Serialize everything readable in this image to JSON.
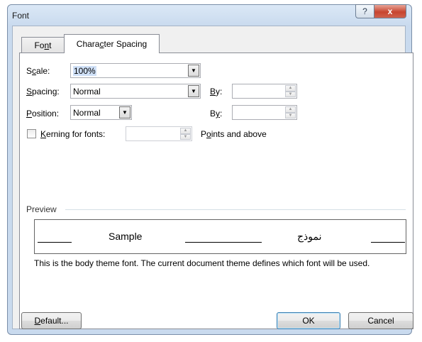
{
  "window": {
    "title": "Font",
    "help_glyph": "?",
    "close_glyph": "x"
  },
  "tabs": [
    {
      "label_pre": "Fo",
      "label_key": "n",
      "label_post": "t"
    },
    {
      "label_pre": "Chara",
      "label_key": "c",
      "label_post": "ter Spacing",
      "active": true
    }
  ],
  "scale": {
    "label_key": "c",
    "label_pre": "S",
    "label_post": "ale:",
    "value": "100%"
  },
  "spacing": {
    "label_key": "S",
    "label_post": "pacing:",
    "value": "Normal",
    "by_label_key": "B",
    "by_label_post": "y:",
    "by_value": ""
  },
  "position": {
    "label_key": "P",
    "label_post": "osition:",
    "value": "Normal",
    "by_label_pre": "B",
    "by_label_key": "y",
    "by_label_post": ":",
    "by_value": ""
  },
  "kerning": {
    "label_key": "K",
    "label_post": "erning for fonts:",
    "checked": false,
    "value": "",
    "suffix_pre": "P",
    "suffix_key": "o",
    "suffix_post": "ints and above"
  },
  "preview": {
    "group_label": "Preview",
    "sample_latin": "Sample",
    "sample_arabic": "نموذج",
    "description": "This is the body theme font. The current document theme defines which font will be used."
  },
  "buttons": {
    "default_key": "D",
    "default_post": "efault...",
    "ok": "OK",
    "cancel": "Cancel"
  },
  "icons": {
    "dropdown": "chevron-down-icon",
    "spin_up": "spin-up-icon",
    "spin_down": "spin-down-icon"
  }
}
